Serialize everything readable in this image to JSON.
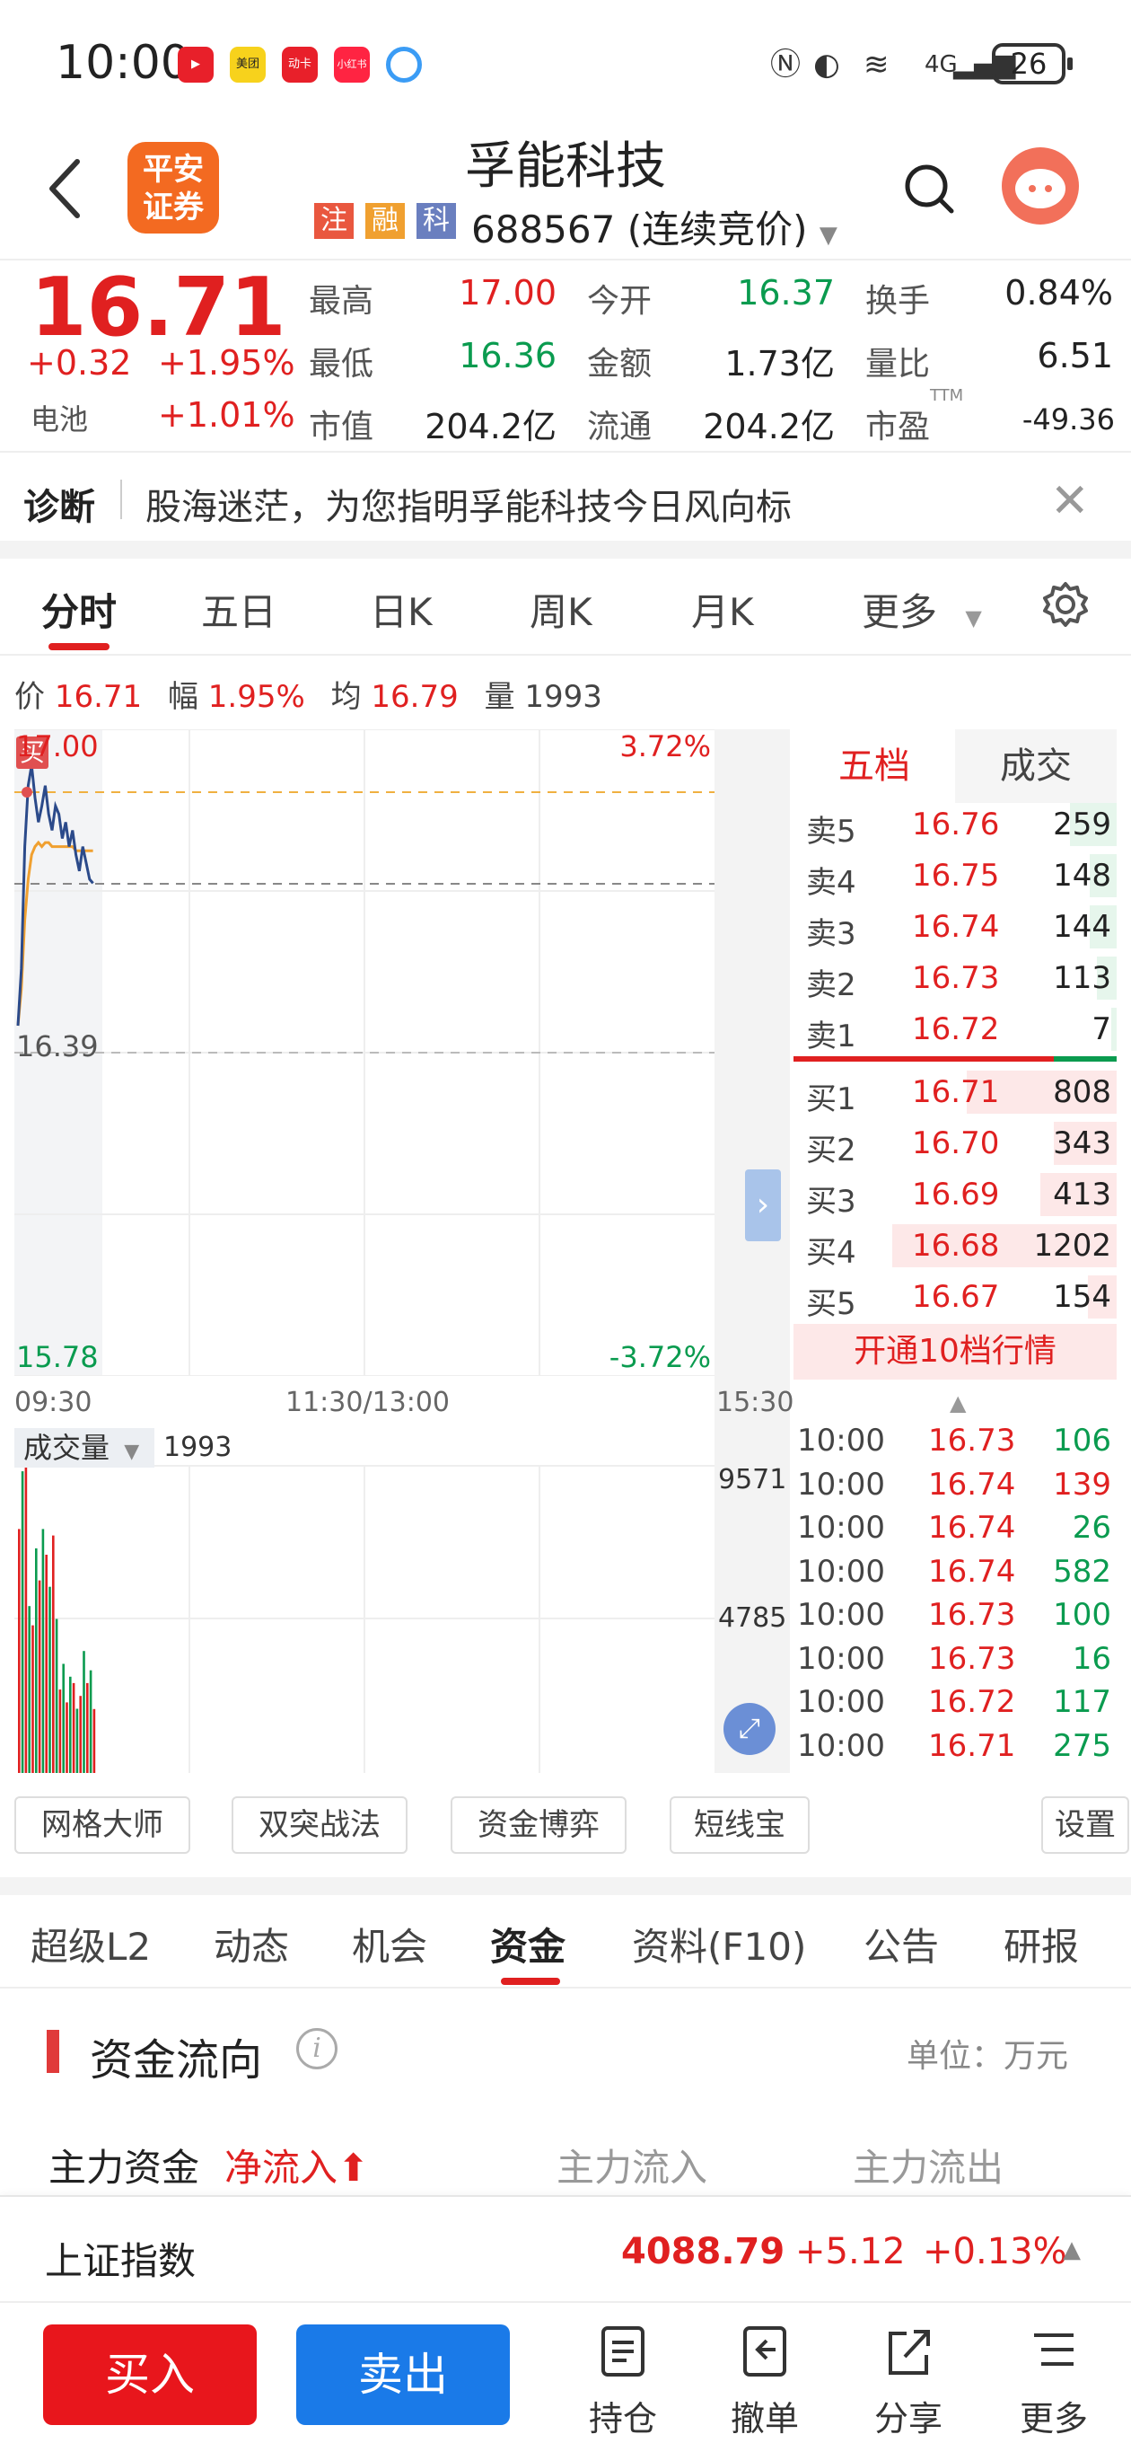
{
  "status_bar": {
    "time": "10:00",
    "apps": [
      {
        "name": "video-app-icon",
        "color": "#e8202a",
        "label": ""
      },
      {
        "name": "meituan-app-icon",
        "color": "#f7d21c",
        "label": "美团"
      },
      {
        "name": "dongfang-app-icon",
        "color": "#e8202a",
        "label": "动卡"
      },
      {
        "name": "xiaohongshu-app-icon",
        "color": "#ff2442",
        "label": "小红书"
      },
      {
        "name": "browser-app-icon",
        "color": "#3b9cf5",
        "label": ""
      }
    ],
    "network": "4G",
    "battery": "26"
  },
  "header": {
    "back_icon": "chevron-left-icon",
    "broker_logo_line1": "平安",
    "broker_logo_line2": "证券",
    "stock_name": "孚能科技",
    "tags": [
      {
        "label": "注",
        "color": "#e9573f"
      },
      {
        "label": "融",
        "color": "#f0a030"
      },
      {
        "label": "科",
        "color": "#6a7fbf"
      }
    ],
    "stock_code": "688567",
    "trading_status": "(连续竞价)",
    "search_icon": "search-icon",
    "assistant_icon": "assistant-avatar-icon"
  },
  "quote": {
    "last_price": "16.71",
    "change": "+0.32",
    "change_pct": "+1.95%",
    "sector_name": "电池",
    "sector_pct": "+1.01%",
    "fields": [
      {
        "label": "最高",
        "value": "17.00",
        "color": "#e02020"
      },
      {
        "label": "今开",
        "value": "16.37",
        "color": "#0a9b4f"
      },
      {
        "label": "换手",
        "value": "0.84%",
        "color": "#222222"
      },
      {
        "label": "最低",
        "value": "16.36",
        "color": "#0a9b4f"
      },
      {
        "label": "金额",
        "value": "1.73亿",
        "color": "#222222"
      },
      {
        "label": "量比",
        "value": "6.51",
        "color": "#222222"
      },
      {
        "label": "市值",
        "value": "204.2亿",
        "color": "#222222"
      },
      {
        "label": "流通",
        "value": "204.2亿",
        "color": "#222222"
      },
      {
        "label": "市盈",
        "value": "-49.36",
        "color": "#222222"
      }
    ],
    "pe_superscript": "TTM"
  },
  "diagnose": {
    "title": "诊断",
    "text": "股海迷茫，为您指明孚能科技今日风向标",
    "close_icon": "close-icon"
  },
  "period_tabs": {
    "items": [
      "分时",
      "五日",
      "日K",
      "周K",
      "月K",
      "更多"
    ],
    "active": "分时",
    "settings_icon": "gear-icon"
  },
  "info_line": {
    "price_label": "价",
    "price": "16.71",
    "amp_label": "幅",
    "amp": "1.95%",
    "avg_label": "均",
    "avg": "16.79",
    "vol_label": "量",
    "vol": "1993"
  },
  "chart": {
    "top_price": "17.00",
    "top_pct": "3.72%",
    "mid_price": "16.39",
    "bottom_price": "15.78",
    "bottom_pct": "-3.72%",
    "buy_marker": "买",
    "x_labels": [
      "09:30",
      "11:30/13:00",
      "15:30"
    ],
    "price_series": [
      16.36,
      16.5,
      16.8,
      16.95,
      17.0,
      16.92,
      16.86,
      16.9,
      16.95,
      16.88,
      16.84,
      16.9,
      16.88,
      16.82,
      16.86,
      16.8,
      16.84,
      16.78,
      16.74,
      16.8,
      16.76,
      16.72,
      16.71
    ],
    "avg_series": [
      16.36,
      16.45,
      16.62,
      16.72,
      16.78,
      16.8,
      16.81,
      16.8,
      16.81,
      16.81,
      16.8,
      16.8,
      16.8,
      16.8,
      16.8,
      16.8,
      16.8,
      16.79,
      16.79,
      16.79,
      16.79,
      16.79,
      16.79
    ],
    "price_min": 15.78,
    "price_max": 17.0
  },
  "volume": {
    "label": "成交量",
    "current": "1993",
    "max_label": "9571",
    "mid_label": "4785",
    "bars": [
      {
        "v": 7600,
        "c": "#e02020"
      },
      {
        "v": 9400,
        "c": "#0a9b4f"
      },
      {
        "v": 9571,
        "c": "#e02020"
      },
      {
        "v": 5200,
        "c": "#0a9b4f"
      },
      {
        "v": 4600,
        "c": "#e02020"
      },
      {
        "v": 7000,
        "c": "#0a9b4f"
      },
      {
        "v": 6000,
        "c": "#e02020"
      },
      {
        "v": 7600,
        "c": "#0a9b4f"
      },
      {
        "v": 6800,
        "c": "#e02020"
      },
      {
        "v": 5800,
        "c": "#0a9b4f"
      },
      {
        "v": 7400,
        "c": "#e02020"
      },
      {
        "v": 4800,
        "c": "#0a9b4f"
      },
      {
        "v": 2600,
        "c": "#e02020"
      },
      {
        "v": 3400,
        "c": "#0a9b4f"
      },
      {
        "v": 2200,
        "c": "#e02020"
      },
      {
        "v": 3000,
        "c": "#0a9b4f"
      },
      {
        "v": 2800,
        "c": "#e02020"
      },
      {
        "v": 2000,
        "c": "#0a9b4f"
      },
      {
        "v": 2400,
        "c": "#e02020"
      },
      {
        "v": 3800,
        "c": "#0a9b4f"
      },
      {
        "v": 2800,
        "c": "#e02020"
      },
      {
        "v": 3200,
        "c": "#0a9b4f"
      },
      {
        "v": 1993,
        "c": "#e02020"
      }
    ]
  },
  "order_book": {
    "tabs": [
      "五档",
      "成交"
    ],
    "active_tab": "五档",
    "asks": [
      {
        "label": "卖5",
        "price": "16.76",
        "vol": "259",
        "ratio": 0.21
      },
      {
        "label": "卖4",
        "price": "16.75",
        "vol": "148",
        "ratio": 0.12
      },
      {
        "label": "卖3",
        "price": "16.74",
        "vol": "144",
        "ratio": 0.12
      },
      {
        "label": "卖2",
        "price": "16.73",
        "vol": "113",
        "ratio": 0.09
      },
      {
        "label": "卖1",
        "price": "16.72",
        "vol": "7",
        "ratio": 0.01
      }
    ],
    "bids": [
      {
        "label": "买1",
        "price": "16.71",
        "vol": "808",
        "ratio": 0.67
      },
      {
        "label": "买2",
        "price": "16.70",
        "vol": "343",
        "ratio": 0.28
      },
      {
        "label": "买3",
        "price": "16.69",
        "vol": "413",
        "ratio": 0.34
      },
      {
        "label": "买4",
        "price": "16.68",
        "vol": "1202",
        "ratio": 1.0
      },
      {
        "label": "买5",
        "price": "16.67",
        "vol": "154",
        "ratio": 0.13
      }
    ],
    "upgrade_label": "开通10档行情"
  },
  "ticks": [
    {
      "time": "10:00",
      "price": "16.73",
      "vol": "106",
      "side": "green"
    },
    {
      "time": "10:00",
      "price": "16.74",
      "vol": "139",
      "side": "red"
    },
    {
      "time": "10:00",
      "price": "16.74",
      "vol": "26",
      "side": "green"
    },
    {
      "time": "10:00",
      "price": "16.74",
      "vol": "582",
      "side": "green"
    },
    {
      "time": "10:00",
      "price": "16.73",
      "vol": "100",
      "side": "green"
    },
    {
      "time": "10:00",
      "price": "16.73",
      "vol": "16",
      "side": "green"
    },
    {
      "time": "10:00",
      "price": "16.72",
      "vol": "117",
      "side": "green"
    },
    {
      "time": "10:00",
      "price": "16.71",
      "vol": "275",
      "side": "green"
    }
  ],
  "tools": {
    "chips": [
      "网格大师",
      "双突战法",
      "资金博弈",
      "短线宝"
    ],
    "settings": "设置"
  },
  "content_tabs": {
    "items": [
      "超级L2",
      "动态",
      "机会",
      "资金",
      "资料(F10)",
      "公告",
      "研报"
    ],
    "active": "资金"
  },
  "fund_flow": {
    "title": "资金流向",
    "info_icon": "info-icon",
    "unit": "单位：万元",
    "main_label": "主力资金",
    "net_in_label": "净流入",
    "in_label": "主力流入",
    "out_label": "主力流出"
  },
  "index_bar": {
    "name": "上证指数",
    "value": "4088.79",
    "change": "+5.12",
    "change_pct": "+0.13%"
  },
  "bottom_bar": {
    "buy": "买入",
    "sell": "卖出",
    "items": [
      {
        "label": "持仓",
        "icon": "holdings-icon"
      },
      {
        "label": "撤单",
        "icon": "cancel-order-icon"
      },
      {
        "label": "分享",
        "icon": "share-icon"
      },
      {
        "label": "更多",
        "icon": "more-list-icon"
      }
    ]
  }
}
